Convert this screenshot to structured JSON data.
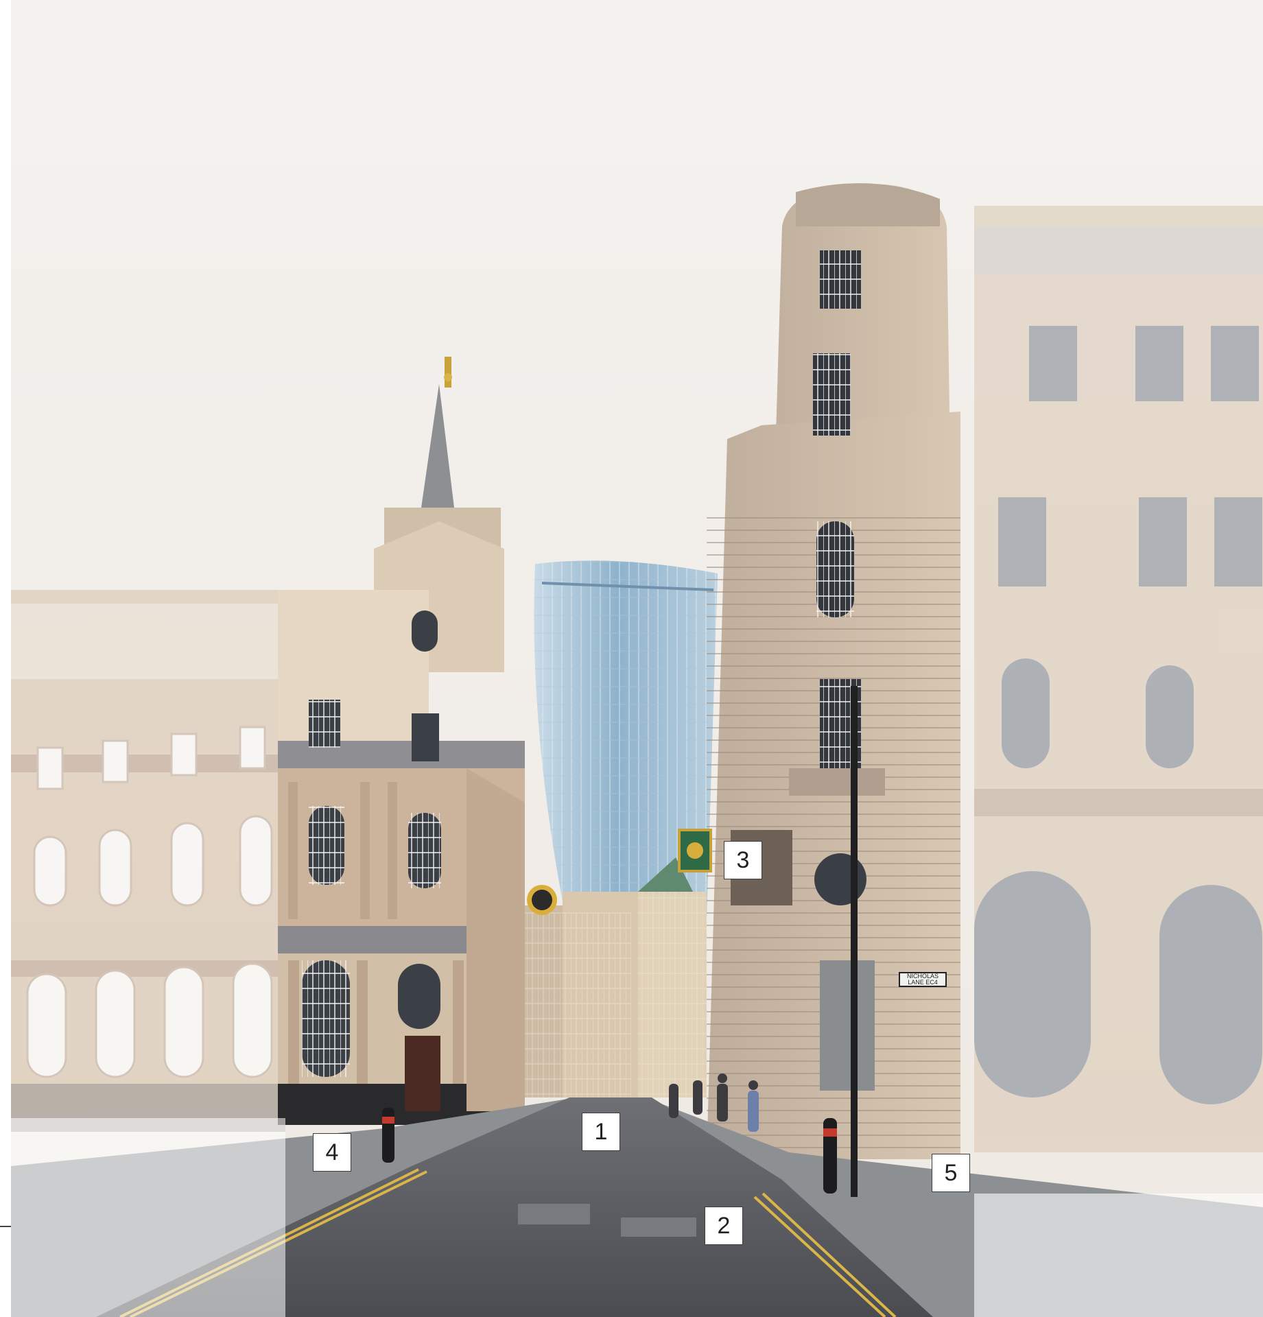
{
  "scene": {
    "description_tag": "london-city-street-photo",
    "colors": {
      "sky": "#f2eeea",
      "stone": "#d7c6b0",
      "stone_shadow": "#a8978a",
      "glass": "#9ab9cf",
      "road": "#55575c",
      "pavement": "#8f9294",
      "road_line": "#d9b54a",
      "washout": "#ffffff"
    }
  },
  "callouts": [
    {
      "id": "1",
      "label": "1"
    },
    {
      "id": "2",
      "label": "2"
    },
    {
      "id": "3",
      "label": "3"
    },
    {
      "id": "4",
      "label": "4"
    },
    {
      "id": "5",
      "label": "5"
    }
  ],
  "signs": {
    "nicholas_lane": "NICHOLAS LANE EC4"
  }
}
